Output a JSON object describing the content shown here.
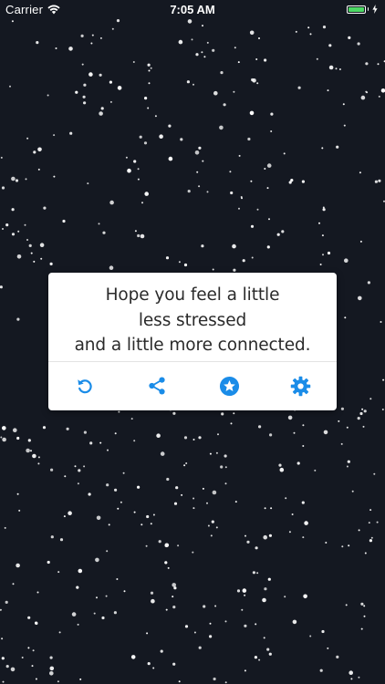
{
  "status_bar": {
    "carrier": "Carrier",
    "time": "7:05 AM",
    "wifi_icon": "wifi-icon",
    "battery_icon": "battery-icon",
    "battery_level": 1.0,
    "charging_icon": "charging-bolt-icon"
  },
  "quote": {
    "lines": [
      "Hope you feel a little",
      "less stressed",
      "and a little more connected."
    ]
  },
  "actions": [
    {
      "icon": "refresh-icon"
    },
    {
      "icon": "share-icon"
    },
    {
      "icon": "star-badge-icon"
    },
    {
      "icon": "gear-icon"
    }
  ],
  "colors": {
    "background": "#141821",
    "accent": "#1a8ce8",
    "card": "#ffffff",
    "text": "#2a2a2a",
    "battery": "#4cd964"
  }
}
